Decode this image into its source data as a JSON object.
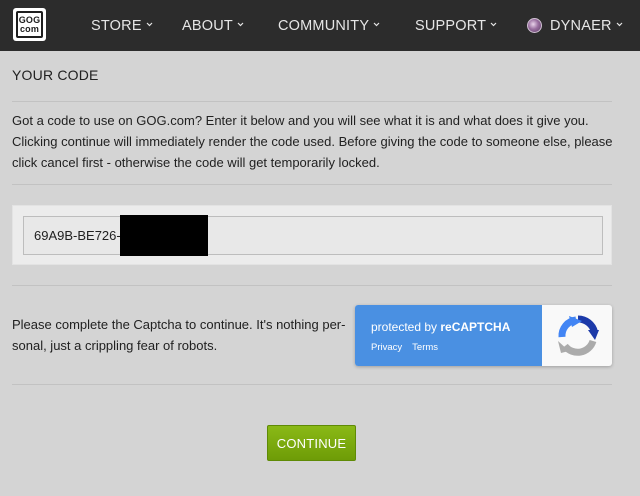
{
  "header": {
    "logo": {
      "line1": "GOG",
      "line2": "com"
    },
    "nav": [
      {
        "label": "STORE"
      },
      {
        "label": "ABOUT"
      },
      {
        "label": "COMMUNITY"
      },
      {
        "label": "SUPPORT"
      }
    ],
    "user": {
      "name": "DYNAER"
    }
  },
  "main": {
    "title": "YOUR CODE",
    "intro_lines": [
      "Got a code to use on GOG.com? Enter it below and you will see what it is and what does it give you.",
      "Clicking continue will immediately render the code used. Before giving the code to someone else, please",
      "click cancel first - otherwise the code will get temporarily locked."
    ],
    "code_value": "69A9B-BE726-",
    "captcha_prompt_lines": [
      "Please complete the Captcha to continue. It's nothing per-",
      "sonal, just a crippling fear of robots."
    ],
    "recaptcha": {
      "protected_text": "protected by ",
      "brand": "reCAPTCHA",
      "privacy_label": "Privacy",
      "terms_label": "Terms"
    },
    "continue_label": "CONTINUE"
  },
  "colors": {
    "topbar": "#2c2c2c",
    "page_bg": "#d4d4d4",
    "recaptcha_blue": "#4a90e2",
    "continue_green": "#7cae00"
  }
}
